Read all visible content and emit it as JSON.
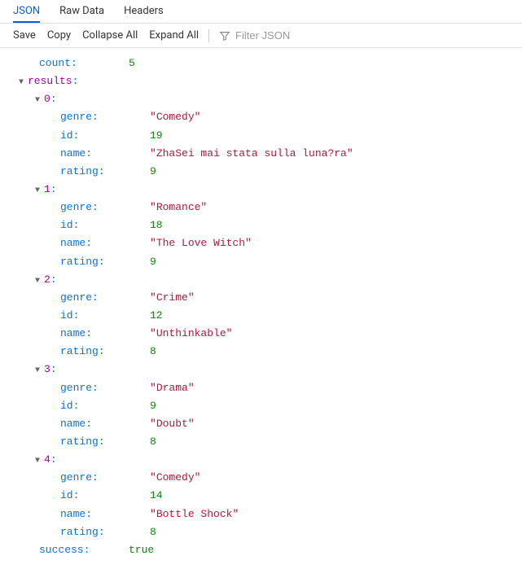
{
  "tabs": {
    "json": "JSON",
    "raw": "Raw Data",
    "headers": "Headers"
  },
  "toolbar": {
    "save": "Save",
    "copy": "Copy",
    "collapse_all": "Collapse All",
    "expand_all": "Expand All",
    "filter_placeholder": "Filter JSON"
  },
  "json": {
    "count_key": "count",
    "count": 5,
    "results_key": "results",
    "results": [
      {
        "genre": "Comedy",
        "id": 19,
        "name": "ZhaSei mai stata sulla luna?ra",
        "rating": 9
      },
      {
        "genre": "Romance",
        "id": 18,
        "name": "The Love Witch",
        "rating": 9
      },
      {
        "genre": "Crime",
        "id": 12,
        "name": "Unthinkable",
        "rating": 8
      },
      {
        "genre": "Drama",
        "id": 9,
        "name": "Doubt",
        "rating": 8
      },
      {
        "genre": "Comedy",
        "id": 14,
        "name": "Bottle Shock",
        "rating": 8
      }
    ],
    "success_key": "success",
    "success": "true",
    "field_labels": {
      "genre": "genre",
      "id": "id",
      "name": "name",
      "rating": "rating"
    },
    "indices": [
      "0",
      "1",
      "2",
      "3",
      "4"
    ]
  }
}
